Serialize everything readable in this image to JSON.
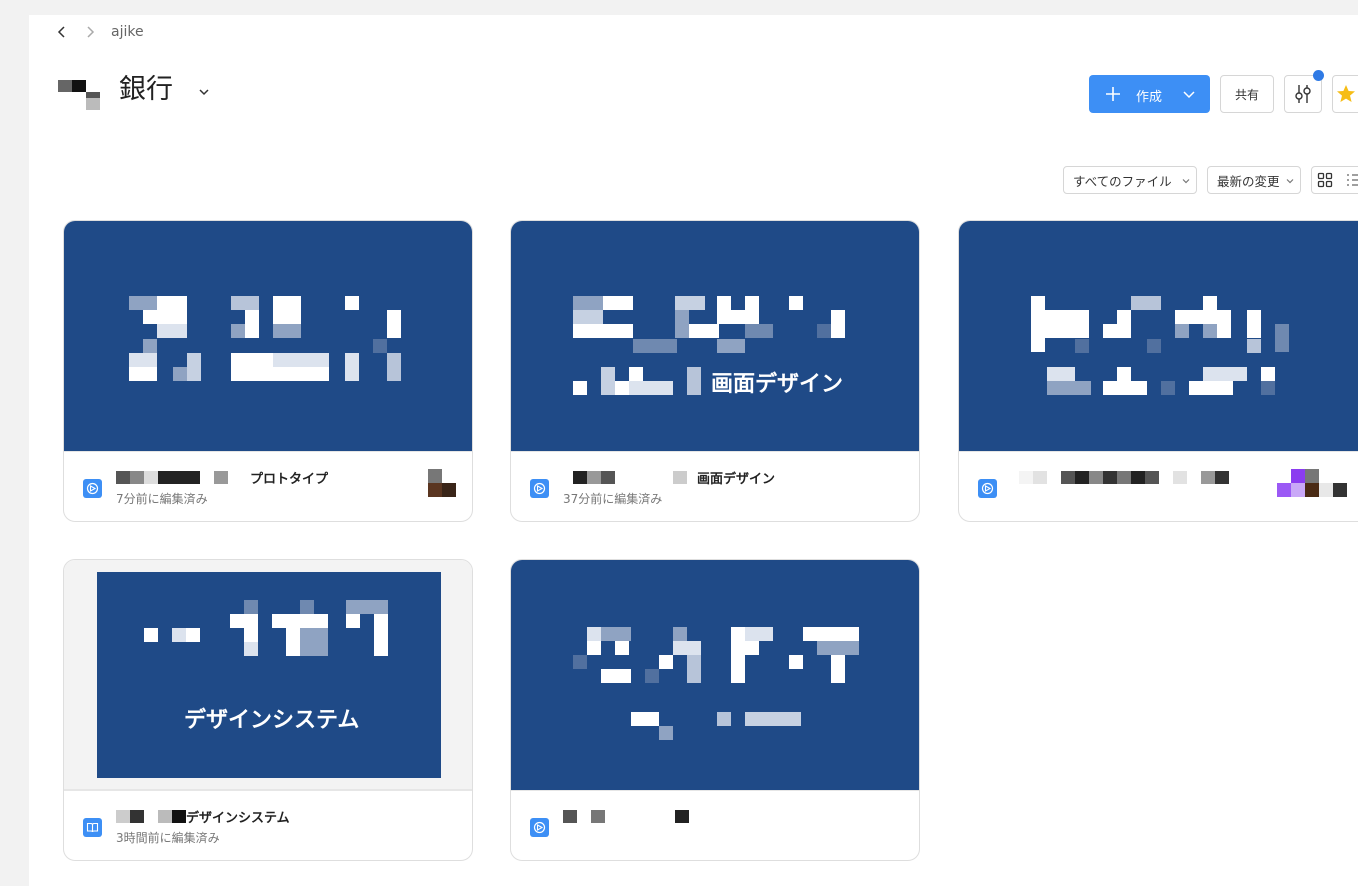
{
  "breadcrumb": {
    "current": "ajike"
  },
  "header": {
    "title": "銀行",
    "create_label": "作成",
    "share_label": "共有"
  },
  "filters": {
    "files_label": "すべてのファイル",
    "sort_label": "最新の変更"
  },
  "colors": {
    "accent": "#3d8ff5",
    "thumb": "#1f4a87",
    "notify_dot": "#2f7ae5"
  },
  "cards": [
    {
      "name": "プロトタイプ",
      "edited": "7分前に編集済み",
      "type_icon": "prototype-icon",
      "thumb_caption": ""
    },
    {
      "name": "画面デザイン",
      "edited": "37分前に編集済み",
      "type_icon": "prototype-icon",
      "thumb_caption": "画面デザイン"
    },
    {
      "name": "",
      "edited": "",
      "type_icon": "prototype-icon",
      "thumb_caption": ""
    },
    {
      "name": "デザインシステム",
      "edited": "3時間前に編集済み",
      "type_icon": "book-icon",
      "thumb_caption": "デザインシステム"
    },
    {
      "name": "",
      "edited": "",
      "type_icon": "prototype-icon",
      "thumb_caption": ""
    }
  ]
}
